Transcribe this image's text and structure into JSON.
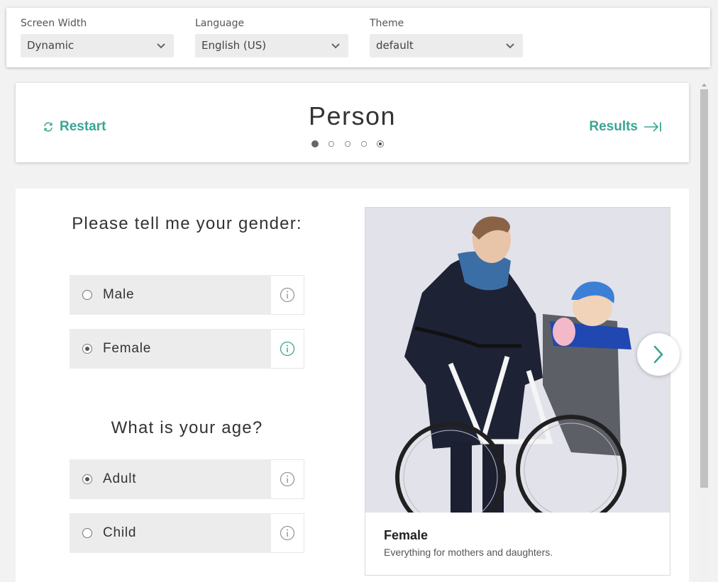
{
  "settings": {
    "screen_width": {
      "label": "Screen Width",
      "value": "Dynamic"
    },
    "language": {
      "label": "Language",
      "value": "English (US)"
    },
    "theme": {
      "label": "Theme",
      "value": "default"
    }
  },
  "header": {
    "restart_label": "Restart",
    "title": "Person",
    "results_label": "Results",
    "steps": [
      {
        "state": "active"
      },
      {
        "state": "inactive"
      },
      {
        "state": "inactive"
      },
      {
        "state": "inactive"
      },
      {
        "state": "current"
      }
    ]
  },
  "questions": [
    {
      "text": "Please tell me your gender:",
      "options": [
        {
          "label": "Male",
          "selected": false
        },
        {
          "label": "Female",
          "selected": true
        }
      ]
    },
    {
      "text": "What is your age?",
      "options": [
        {
          "label": "Adult",
          "selected": true
        },
        {
          "label": "Child",
          "selected": false
        }
      ]
    }
  ],
  "product": {
    "title": "Female",
    "description": "Everything for mothers and daughters."
  },
  "colors": {
    "accent": "#3aa592",
    "page_bg": "#f2f2f2",
    "option_bg": "#ececec"
  }
}
